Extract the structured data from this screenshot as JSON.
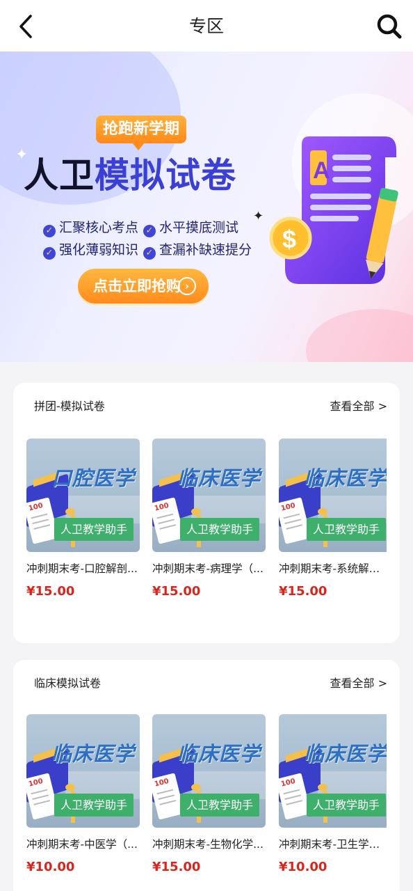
{
  "header": {
    "title": "专区"
  },
  "banner": {
    "tag": "抢跑新学期",
    "title_dark": "人卫",
    "title_blue": "模拟试卷",
    "features": [
      "汇聚核心考点",
      "水平摸底测试",
      "强化薄弱知识",
      "查漏补缺速提分"
    ],
    "cta": "点击立即抢购"
  },
  "sections": [
    {
      "title": "拼团-模拟试卷",
      "view_all": "查看全部 >",
      "products": [
        {
          "thumb_title": "口腔医学",
          "badge": "人卫教学助手",
          "name": "冲刺期末考-口腔解剖...",
          "price": "¥15.00"
        },
        {
          "thumb_title": "临床医学",
          "badge": "人卫教学助手",
          "name": "冲刺期末考-病理学（...",
          "price": "¥15.00"
        },
        {
          "thumb_title": "临床医学",
          "badge": "人卫教学助手",
          "name": "冲刺期末考-系统解剖...",
          "price": "¥15.00"
        }
      ]
    },
    {
      "title": "临床模拟试卷",
      "view_all": "查看全部 >",
      "products": [
        {
          "thumb_title": "临床医学",
          "badge": "人卫教学助手",
          "name": "冲刺期末考-中医学（...",
          "price": "¥10.00"
        },
        {
          "thumb_title": "临床医学",
          "badge": "人卫教学助手",
          "name": "冲刺期末考-生物化学...",
          "price": "¥15.00"
        },
        {
          "thumb_title": "临床医学",
          "badge": "人卫教学助手",
          "name": "冲刺期末考-卫生学（...",
          "price": "¥10.00"
        }
      ]
    }
  ],
  "colors": {
    "price": "#d9261c",
    "badge": "#3fb06c",
    "cta": "#ff8b1d",
    "title_blue": "#3a3fd6"
  },
  "icons": {
    "back": "chevron-left-icon",
    "search": "search-icon"
  }
}
